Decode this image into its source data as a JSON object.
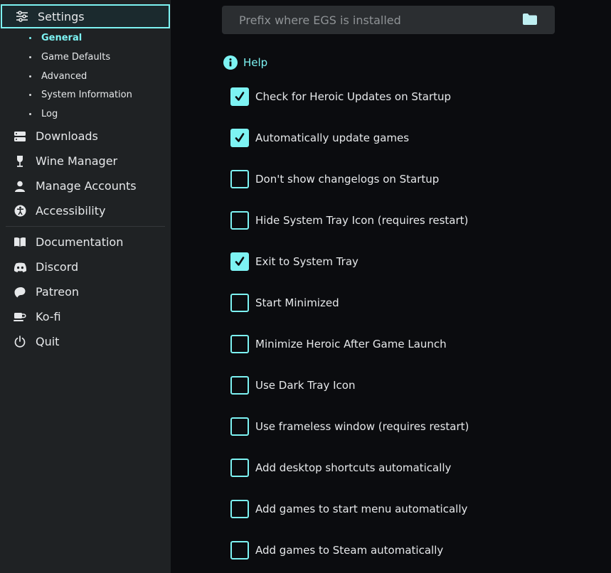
{
  "sidebar": {
    "settings_label": "Settings",
    "sub_items": [
      "General",
      "Game Defaults",
      "Advanced",
      "System Information",
      "Log"
    ],
    "items": [
      {
        "label": "Downloads",
        "icon": "downloads-icon"
      },
      {
        "label": "Wine Manager",
        "icon": "wine-glass-icon"
      },
      {
        "label": "Manage Accounts",
        "icon": "user-icon"
      },
      {
        "label": "Accessibility",
        "icon": "accessibility-icon"
      }
    ],
    "links": [
      {
        "label": "Documentation",
        "icon": "book-icon"
      },
      {
        "label": "Discord",
        "icon": "discord-icon"
      },
      {
        "label": "Patreon",
        "icon": "patreon-icon"
      },
      {
        "label": "Ko-fi",
        "icon": "coffee-cup-icon"
      },
      {
        "label": "Quit",
        "icon": "power-icon"
      }
    ]
  },
  "main": {
    "prefix_placeholder": "Prefix where EGS is installed",
    "help_label": "Help",
    "options": [
      {
        "label": "Check for Heroic Updates on Startup",
        "checked": true
      },
      {
        "label": "Automatically update games",
        "checked": true
      },
      {
        "label": "Don't show changelogs on Startup",
        "checked": false
      },
      {
        "label": "Hide System Tray Icon (requires restart)",
        "checked": false
      },
      {
        "label": "Exit to System Tray",
        "checked": true
      },
      {
        "label": "Start Minimized",
        "checked": false
      },
      {
        "label": "Minimize Heroic After Game Launch",
        "checked": false
      },
      {
        "label": "Use Dark Tray Icon",
        "checked": false
      },
      {
        "label": "Use frameless window (requires restart)",
        "checked": false
      },
      {
        "label": "Add desktop shortcuts automatically",
        "checked": false
      },
      {
        "label": "Add games to start menu automatically",
        "checked": false
      },
      {
        "label": "Add games to Steam automatically",
        "checked": false
      }
    ]
  },
  "colors": {
    "accent": "#7df3f3",
    "sidebar_bg": "#1f2224",
    "main_bg": "#0b0c0f",
    "text": "#e6e8ea"
  }
}
